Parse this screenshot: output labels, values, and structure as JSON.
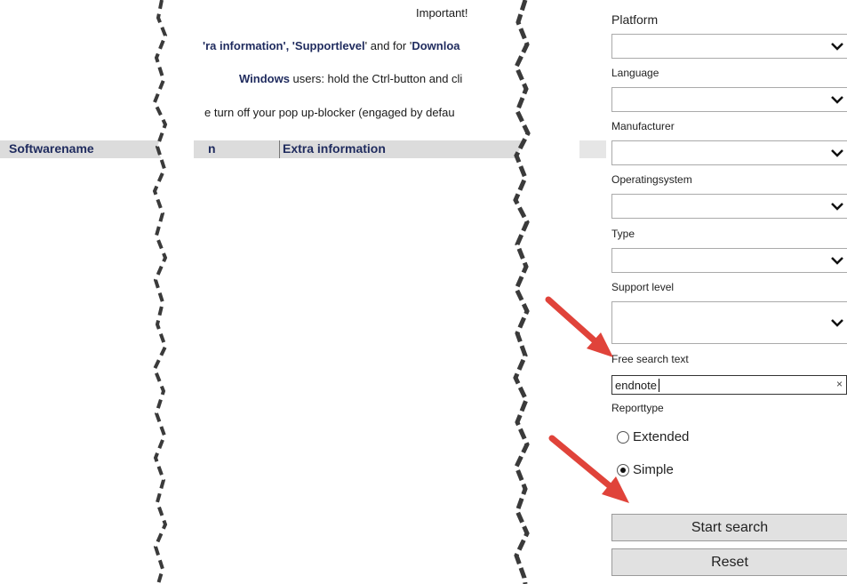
{
  "left": {
    "col_softwarename": "Softwarename"
  },
  "middle": {
    "important": "Important!",
    "line2": {
      "pre": "'ra information', '",
      "b1": "Supportlevel",
      "mid": "' and for '",
      "b2": "Downloa"
    },
    "line3": {
      "b": "Windows",
      "rest": " users: hold the Ctrl-button and cli"
    },
    "line4": "e turn off your pop up-blocker (engaged by defau",
    "col_partial": "n",
    "col_extra": "Extra information"
  },
  "panel": {
    "platform_label": "Platform",
    "language_label": "Language",
    "manufacturer_label": "Manufacturer",
    "os_label": "Operatingsystem",
    "type_label": "Type",
    "support_label": "Support level",
    "free_search_label": "Free search text",
    "free_search_value": "endnote",
    "clear_icon": "×",
    "reporttype_label": "Reporttype",
    "radio_extended": "Extended",
    "radio_simple": "Simple",
    "start_button": "Start search",
    "reset_button": "Reset"
  },
  "colors": {
    "header_text": "#1f2b5e",
    "arrow": "#e0433a",
    "button_bg": "#e1e1e1"
  }
}
